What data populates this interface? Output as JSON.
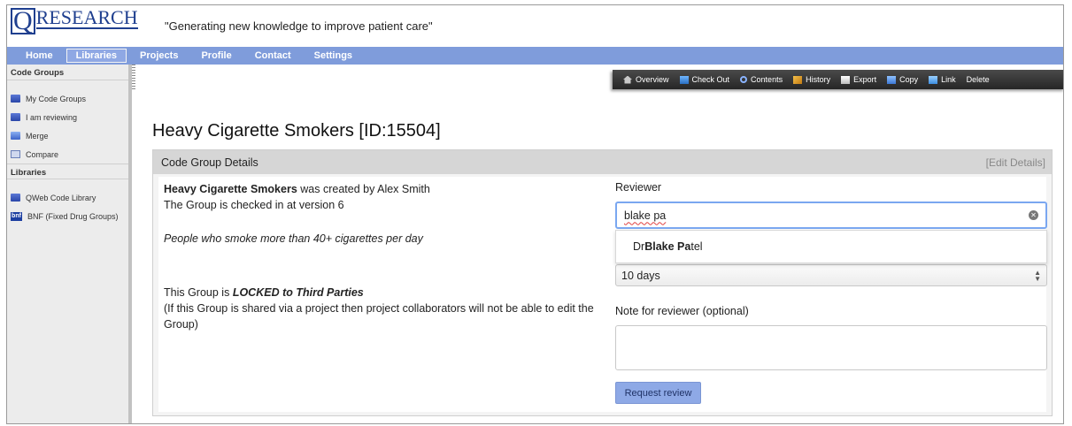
{
  "brand": {
    "logo_q": "Q",
    "logo_text": "RESEARCH",
    "tagline": "\"Generating new knowledge to improve patient care\""
  },
  "nav": {
    "items": [
      {
        "label": "Home"
      },
      {
        "label": "Libraries",
        "active": true
      },
      {
        "label": "Projects"
      },
      {
        "label": "Profile"
      },
      {
        "label": "Contact"
      },
      {
        "label": "Settings"
      }
    ],
    "color": "#7f9cdb"
  },
  "sidebar": {
    "code_groups_header": "Code Groups",
    "code_group_items": [
      {
        "label": "My Code Groups",
        "icon": "book-icon"
      },
      {
        "label": "I am reviewing",
        "icon": "book-icon"
      },
      {
        "label": "Merge",
        "icon": "merge-icon"
      },
      {
        "label": "Compare",
        "icon": "compare-icon"
      }
    ],
    "libraries_header": "Libraries",
    "library_items": [
      {
        "label": "QWeb Code Library",
        "icon": "book-icon"
      },
      {
        "label": "BNF (Fixed Drug Groups)",
        "icon": "bnf-icon",
        "icon_text": "bnf"
      }
    ]
  },
  "toolbar": {
    "items": [
      {
        "label": "Overview",
        "icon": "home-icon"
      },
      {
        "label": "Check Out",
        "icon": "checkout-icon"
      },
      {
        "label": "Contents",
        "icon": "search-icon"
      },
      {
        "label": "History",
        "icon": "history-icon"
      },
      {
        "label": "Export",
        "icon": "export-icon"
      },
      {
        "label": "Copy",
        "icon": "copy-icon"
      },
      {
        "label": "Link",
        "icon": "link-icon"
      },
      {
        "label": "Delete",
        "icon": ""
      }
    ]
  },
  "page": {
    "title": "Heavy Cigarette Smokers [ID:15504]"
  },
  "panel": {
    "title": "Code Group Details",
    "edit_label": "[Edit Details]",
    "group_name": "Heavy Cigarette Smokers",
    "created_by_text": " was created by Alex Smith",
    "version_text": "The Group is checked in at version 6",
    "description": "People who smoke more than 40+ cigarettes per day",
    "lock_prefix": "This Group is ",
    "lock_status": "LOCKED to Third Parties",
    "lock_note": "(If this Group is shared via a project then project collaborators will not be able to edit the Group)"
  },
  "review_form": {
    "reviewer_label": "Reviewer",
    "reviewer_value": "blake pa",
    "suggestion_prefix": "Dr ",
    "suggestion_match_first": "Blake",
    "suggestion_match_second": "Pa",
    "suggestion_rest": "tel",
    "duration_value": "10 days",
    "note_label": "Note for reviewer (optional)",
    "note_value": "",
    "request_button": "Request review",
    "accent_color": "#8ea9e6"
  }
}
